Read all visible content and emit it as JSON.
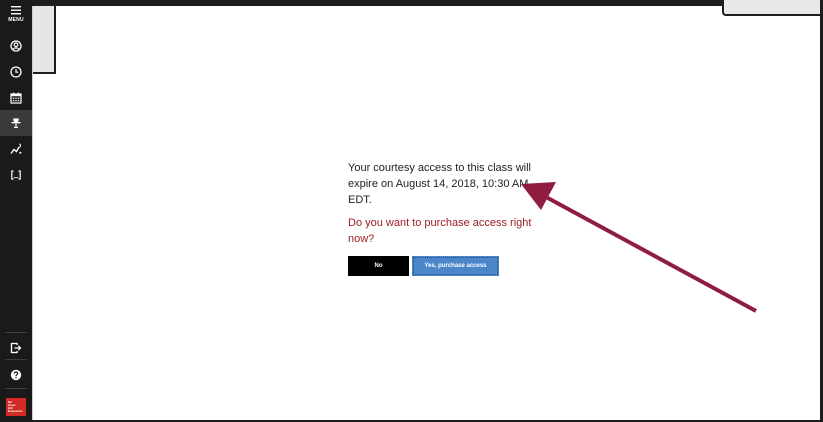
{
  "sidebar": {
    "menu_label": "MENU",
    "items": [
      {
        "name": "profile-icon"
      },
      {
        "name": "clock-icon"
      },
      {
        "name": "calendar-icon"
      },
      {
        "name": "lamp-icon",
        "active": true
      },
      {
        "name": "progress-chart-icon"
      },
      {
        "name": "brackets-icon"
      }
    ],
    "bottom_items": [
      {
        "name": "exit-icon"
      },
      {
        "name": "help-icon"
      }
    ],
    "brand_lines": [
      "Mc",
      "Graw",
      "Hill",
      "Education"
    ]
  },
  "dialog": {
    "message": "Your courtesy access to this class will expire on August 14, 2018, 10:30 AM EDT.",
    "question": "Do you want to purchase access right now?",
    "no_label": "No",
    "yes_label": "Yes, purchase access"
  },
  "colors": {
    "sidebar_bg": "#1a1a1a",
    "question_text": "#9b1b1e",
    "yes_button": "#4a86c8",
    "no_button": "#000000",
    "annotation_arrow": "#8f1d3f",
    "brand_red": "#d12b23"
  }
}
